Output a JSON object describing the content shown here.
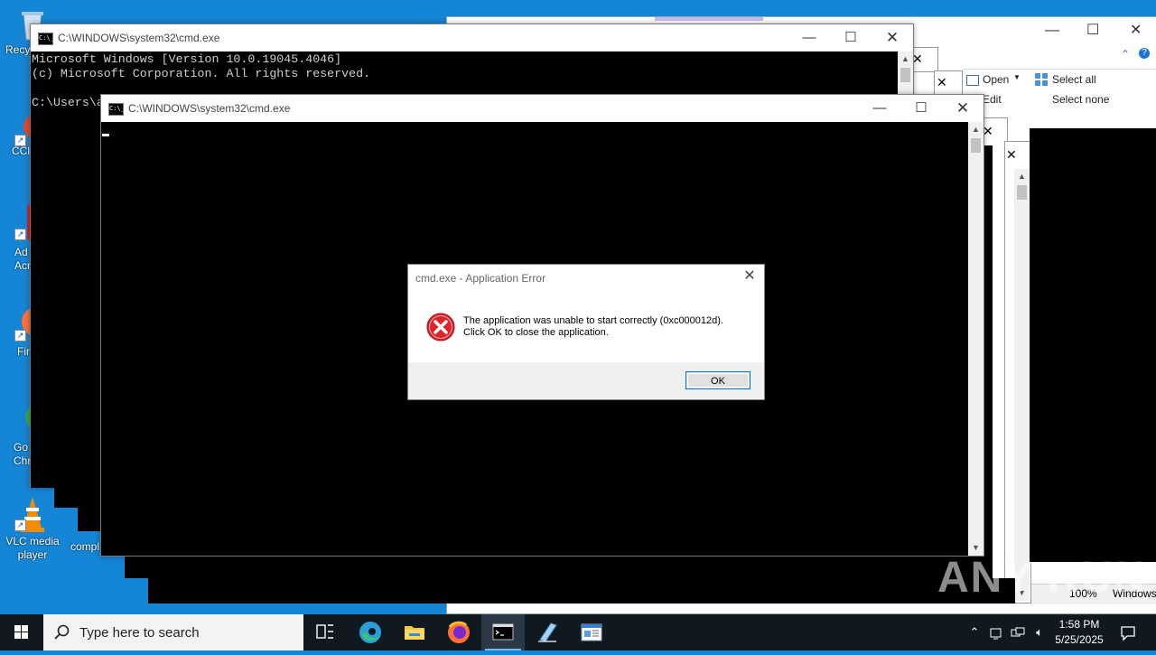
{
  "desktop": {
    "icons": [
      {
        "label": "Recy",
        "name": "recycle-bin"
      },
      {
        "label": "CCl",
        "name": "ccleaner"
      },
      {
        "label": "Ad\nAcr",
        "name": "adobe-acrobat"
      },
      {
        "label": "Fir",
        "name": "firefox"
      },
      {
        "label": "Go\nChr",
        "name": "google-chrome"
      },
      {
        "label": "VLC media\nplayer",
        "name": "vlc"
      },
      {
        "label": "compl",
        "name": "compl-file"
      }
    ]
  },
  "explorer": {
    "ribbon": {
      "open_label": "Open",
      "edit_label": "Edit",
      "select_all_label": "Select all",
      "select_none_label": "Select none"
    },
    "status": {
      "zoom": "100%",
      "encoding": "Windows"
    }
  },
  "cmd_back": {
    "title": "C:\\WINDOWS\\system32\\cmd.exe",
    "lines": "Microsoft Windows [Version 10.0.19045.4046]\n(c) Microsoft Corporation. All rights reserved.\n\nC:\\Users\\a"
  },
  "cmd_front": {
    "title": "C:\\WINDOWS\\system32\\cmd.exe"
  },
  "dialog": {
    "title": "cmd.exe - Application Error",
    "message_line1": "The application was unable to start correctly (0xc000012d).",
    "message_line2": "Click OK to close the application.",
    "ok_label": "OK"
  },
  "taskbar": {
    "search_placeholder": "Type here to search",
    "time": "1:58 PM",
    "date": "5/25/2025"
  },
  "watermark": "ANY RUN",
  "colors": {
    "desktop": "#1585d6",
    "taskbar": "#101820",
    "error_red": "#d9262c",
    "accent": "#0078d7"
  }
}
